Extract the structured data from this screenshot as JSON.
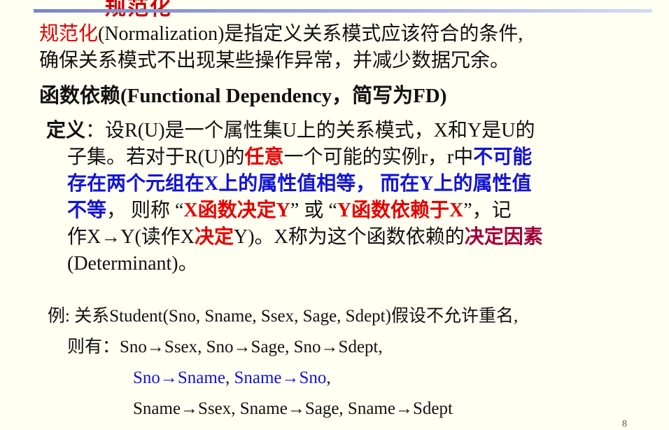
{
  "title_fragment": "规范化",
  "intro": {
    "term": "规范化",
    "line1_rest": "(Normalization)是指定义关系模式应该符合的条件,",
    "line2": "确保关系模式不出现某些操作异常，并减少数据冗余。"
  },
  "fd_heading": "函数依赖(Functional  Dependency，简写为FD)",
  "definition": {
    "label": "定义",
    "colon": "：",
    "l1": "设R(U)是一个属性集U上的关系模式，X和Y是U的",
    "l2a": "子集。若对于R(U)的",
    "l2_any": "任意",
    "l2b": "一个可能的实例r，r中",
    "l2_blue": "不可能",
    "l3_blue": "存在两个元组在X上的属性值相等， 而在Y上的属性值",
    "l4_blue": "不等",
    "l4a": "， 则称 “",
    "l4_red1": "X函数决定Y",
    "l4b": "” 或 “",
    "l4_red2": "Y函数依赖于X",
    "l4c": "”，记",
    "l5a": "作X→Y(读作X",
    "l5_red": "决定",
    "l5b": "Y)。X称为这个函数依赖的",
    "l5_purple": "决定因素",
    "l6": "(Determinant)。"
  },
  "example": {
    "line1": "例: 关系Student(Sno, Sname, Ssex, Sage, Sdept)假设不允许重名,",
    "line2_label": "则有：",
    "line2_deps": "Sno→Ssex, Sno→Sage, Sno→Sdept,",
    "line3_dep1": "Sno→Sname",
    "line3_sep": ", ",
    "line3_dep2": "Sname→Sno",
    "line3_end": ",",
    "line4": "Sname→Ssex, Sname→Sage, Sname→Sdept"
  },
  "page_number": "8",
  "colors": {
    "background": "#fffff2",
    "red": "#e60000",
    "blue": "#1313d8",
    "purple": "#a0003c",
    "rule": "#7b86c8"
  }
}
